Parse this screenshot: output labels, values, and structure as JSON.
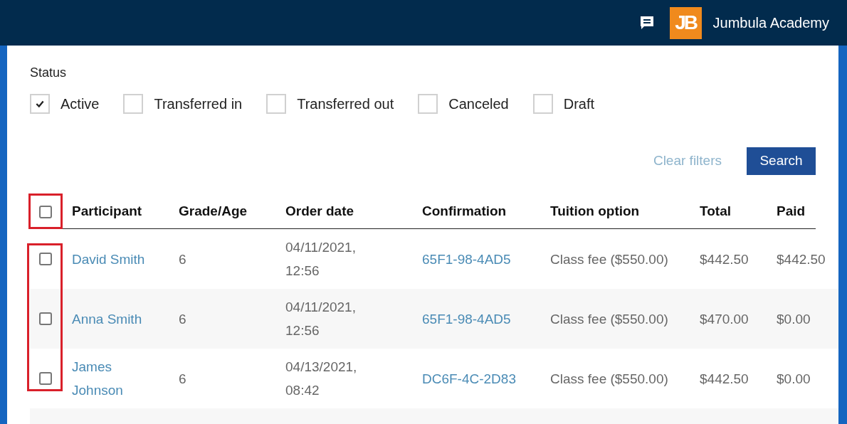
{
  "header": {
    "logo_text": "JB",
    "org_name": "Jumbula Academy"
  },
  "filters": {
    "label": "Status",
    "options": [
      {
        "label": "Active",
        "checked": true
      },
      {
        "label": "Transferred in",
        "checked": false
      },
      {
        "label": "Transferred out",
        "checked": false
      },
      {
        "label": "Canceled",
        "checked": false
      },
      {
        "label": "Draft",
        "checked": false
      }
    ]
  },
  "actions": {
    "clear": "Clear filters",
    "search": "Search"
  },
  "table": {
    "select_all": {
      "checked": false,
      "highlighted": true
    },
    "row_checkboxes_highlighted": true,
    "columns": [
      "Participant",
      "Grade/Age",
      "Order date",
      "Confirmation",
      "Tuition option",
      "Total",
      "Paid"
    ],
    "rows": [
      {
        "selected": false,
        "participant": "David Smith",
        "grade": "6",
        "order_date": "04/11/2021, 12:56",
        "confirmation": "65F1-98-4AD5",
        "tuition": "Class fee ($550.00)",
        "total": "$442.50",
        "paid": "$442.50"
      },
      {
        "selected": false,
        "participant": "Anna Smith",
        "grade": "6",
        "order_date": "04/11/2021, 12:56",
        "confirmation": "65F1-98-4AD5",
        "tuition": "Class fee ($550.00)",
        "total": "$470.00",
        "paid": "$0.00"
      },
      {
        "selected": false,
        "participant": "James Johnson",
        "grade": "6",
        "order_date": "04/13/2021, 08:42",
        "confirmation": "DC6F-4C-2D83",
        "tuition": "Class fee ($550.00)",
        "total": "$442.50",
        "paid": "$0.00"
      }
    ]
  }
}
